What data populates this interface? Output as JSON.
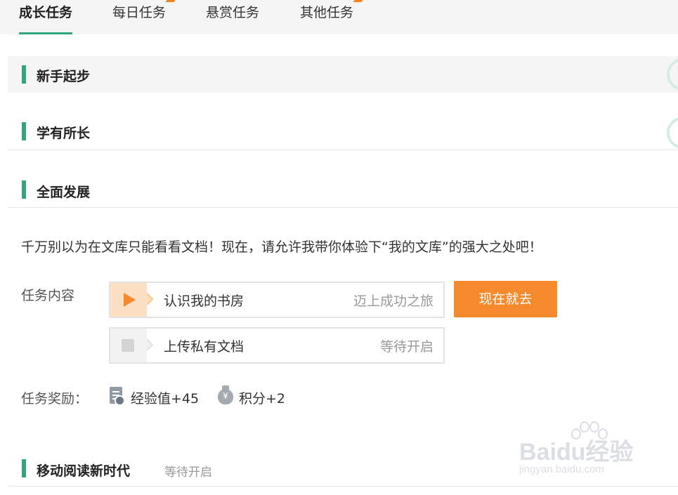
{
  "tabs": [
    {
      "label": "成长任务",
      "active": true,
      "flag": false
    },
    {
      "label": "每日任务",
      "active": false,
      "flag": true
    },
    {
      "label": "悬赏任务",
      "active": false,
      "flag": false
    },
    {
      "label": "其他任务",
      "active": false,
      "flag": true
    }
  ],
  "sections": {
    "beginner": {
      "title": "新手起步"
    },
    "learning": {
      "title": "学有所长"
    },
    "development": {
      "title": "全面发展"
    },
    "mobile": {
      "title": "移动阅读新时代",
      "status": "等待开启"
    }
  },
  "development": {
    "description": "千万别以为在文库只能看看文档！现在，请允许我带你体验下“我的文库”的强大之处吧！",
    "content_label": "任务内容",
    "tasks": [
      {
        "name": "认识我的书房",
        "status": "迈上成功之旅",
        "active": true
      },
      {
        "name": "上传私有文档",
        "status": "等待开启",
        "active": false
      }
    ],
    "go_button": "现在就去",
    "reward_label": "任务奖励：",
    "rewards": {
      "experience": "经验值+45",
      "points": "积分+2"
    }
  },
  "watermark": {
    "logo": "Baidu经验",
    "url": "jingyan.baidu.com"
  },
  "colors": {
    "accent_green": "#2fa77a",
    "accent_orange": "#f58a2c"
  }
}
